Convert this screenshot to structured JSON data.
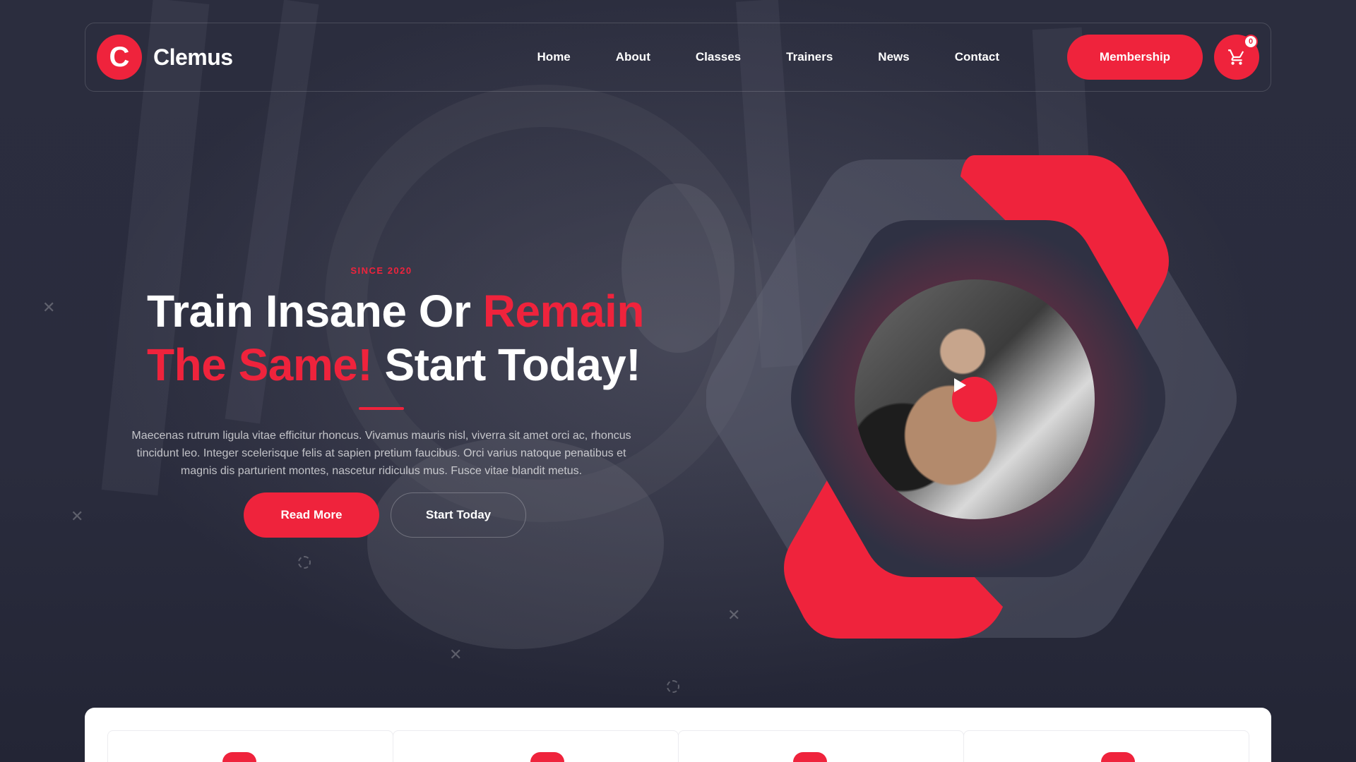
{
  "brand": {
    "logo_letter": "C",
    "name": "Clemus"
  },
  "nav": {
    "items": [
      "Home",
      "About",
      "Classes",
      "Trainers",
      "News",
      "Contact"
    ],
    "membership_label": "Membership",
    "cart_count": "0"
  },
  "hero": {
    "eyebrow": "SINCE 2020",
    "headline_part1": "Train Insane Or ",
    "headline_part2": "Remain",
    "headline_part3": "The Same!",
    "headline_part4": " Start Today!",
    "description": "Maecenas rutrum ligula vitae efficitur rhoncus. Vivamus mauris nisl, viverra sit amet orci ac, rhoncus tincidunt leo. Integer scelerisque felis at sapien pretium faucibus. Orci varius natoque penatibus et magnis dis parturient montes, nascetur ridiculus mus. Fusce vitae blandit metus.",
    "read_more_label": "Read More",
    "start_today_label": "Start Today"
  },
  "icons": {
    "cart": "cart-icon",
    "play": "play-icon",
    "decor": "cross-icon"
  },
  "colors": {
    "accent": "#ef233c",
    "background": "#262839",
    "white": "#ffffff"
  }
}
